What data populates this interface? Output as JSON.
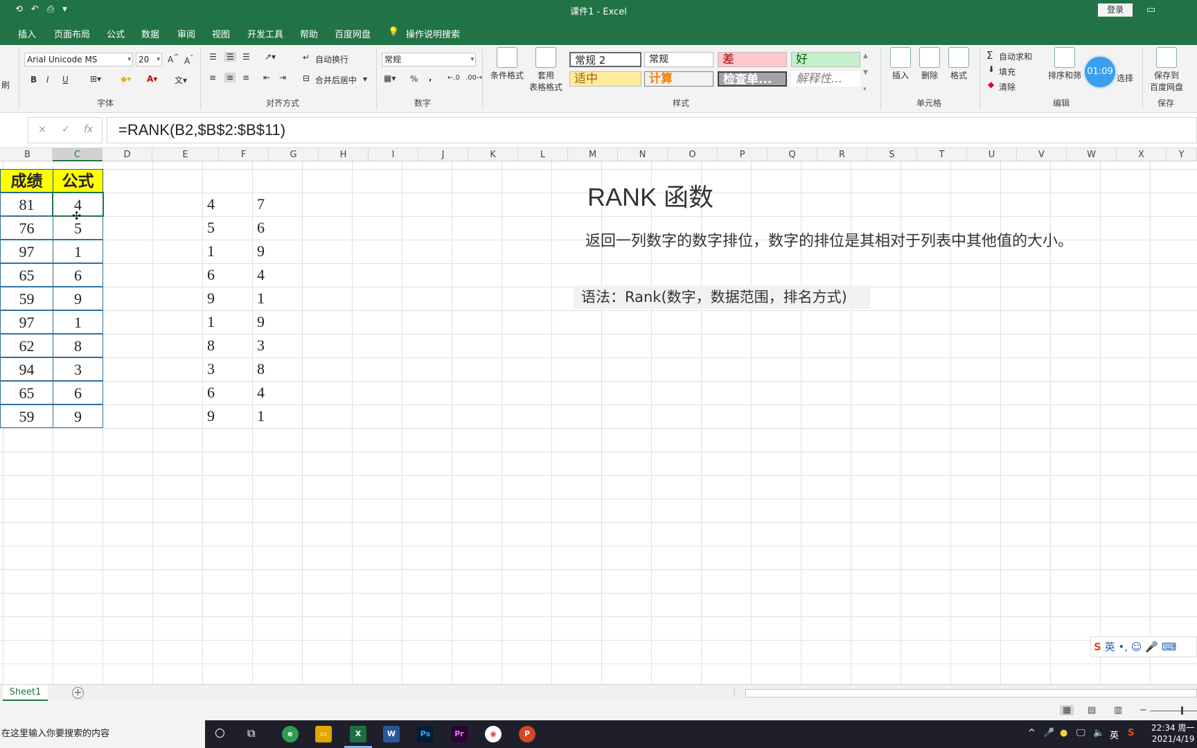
{
  "window": {
    "title": "课件1  -  Excel",
    "login_label": "登录"
  },
  "tabs": [
    "插入",
    "页面布局",
    "公式",
    "数据",
    "审阅",
    "视图",
    "开发工具",
    "帮助",
    "百度网盘",
    "操作说明搜索"
  ],
  "ribbon": {
    "left_edge_label": "刷",
    "font_name": "Arial Unicode MS",
    "font_size": "20",
    "bold": "B",
    "italic": "I",
    "underline": "U",
    "wrap_text": "自动换行",
    "merge_center": "合并后居中",
    "number_format": "常规",
    "percent": "%",
    "comma": ",",
    "cond_format": "条件格式",
    "table_format_1": "套用",
    "table_format_2": "表格格式",
    "styles": {
      "s1": "常规 2",
      "s2": "常规",
      "s3": "差",
      "s4": "好",
      "s5": "适中",
      "s6": "计算",
      "s7": "检查单...",
      "s8": "解释性..."
    },
    "insert": "插入",
    "delete": "删除",
    "format": "格式",
    "autosum": "自动求和",
    "fill": "填充",
    "clear": "清除",
    "sort_filter": "排序和筛",
    "select": "选择",
    "save_baidu_1": "保存到",
    "save_baidu_2": "百度网盘",
    "groups": {
      "font": "字体",
      "align": "对齐方式",
      "number": "数字",
      "styles": "样式",
      "cells": "单元格",
      "edit": "编辑",
      "save": "保存"
    }
  },
  "timer": "01:09",
  "formula_bar": {
    "cancel": "×",
    "enter": "✓",
    "fx": "fx",
    "formula": "=RANK(B2,$B$2:$B$11)"
  },
  "columns": [
    "B",
    "C",
    "D",
    "E",
    "F",
    "G",
    "H",
    "I",
    "J",
    "K",
    "L",
    "M",
    "N",
    "O",
    "P",
    "Q",
    "R",
    "S",
    "T",
    "U",
    "V",
    "W",
    "X",
    "Y"
  ],
  "table": {
    "header_b": "成绩",
    "header_c": "公式",
    "b": [
      "81",
      "76",
      "97",
      "65",
      "59",
      "97",
      "62",
      "94",
      "65",
      "59"
    ],
    "c": [
      "4",
      "5",
      "1",
      "6",
      "9",
      "1",
      "8",
      "3",
      "6",
      "9"
    ],
    "e": [
      "4",
      "5",
      "1",
      "6",
      "9",
      "1",
      "8",
      "3",
      "6",
      "9"
    ],
    "f": [
      "7",
      "6",
      "9",
      "4",
      "1",
      "9",
      "3",
      "8",
      "4",
      "1"
    ]
  },
  "notes": {
    "title": "RANK 函数",
    "desc": "返回一列数字的数字排位，数字的排位是其相对于列表中其他值的大小。",
    "syntax": "语法：Rank(数字，数据范围，排名方式)"
  },
  "sheet": {
    "tab": "Sheet1",
    "add": "+"
  },
  "status": {
    "zoom_minus": "−"
  },
  "ime": "英",
  "taskbar": {
    "search_placeholder": "在这里输入你要搜索的内容",
    "time": "22:34 周一",
    "date": "2021/4/19",
    "lang": "英"
  }
}
